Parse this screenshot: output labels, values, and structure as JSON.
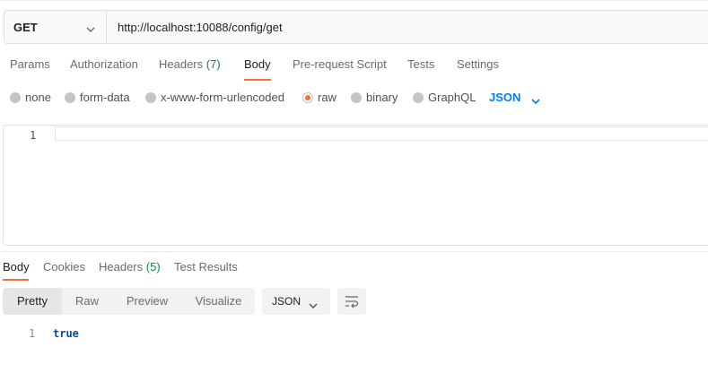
{
  "request": {
    "method": "GET",
    "url": "http://localhost:10088/config/get"
  },
  "request_tabs": [
    {
      "label": "Params"
    },
    {
      "label": "Authorization"
    },
    {
      "label": "Headers",
      "count": "(7)"
    },
    {
      "label": "Body",
      "active": true
    },
    {
      "label": "Pre-request Script"
    },
    {
      "label": "Tests"
    },
    {
      "label": "Settings"
    }
  ],
  "body_types": [
    {
      "label": "none"
    },
    {
      "label": "form-data"
    },
    {
      "label": "x-www-form-urlencoded"
    },
    {
      "label": "raw",
      "selected": true
    },
    {
      "label": "binary"
    },
    {
      "label": "GraphQL"
    }
  ],
  "body_language": "JSON",
  "editor": {
    "line_numbers": [
      "1"
    ],
    "content": ""
  },
  "response_tabs": [
    {
      "label": "Body",
      "active": true
    },
    {
      "label": "Cookies"
    },
    {
      "label": "Headers",
      "count": "(5)"
    },
    {
      "label": "Test Results"
    }
  ],
  "response_views": [
    {
      "label": "Pretty",
      "active": true
    },
    {
      "label": "Raw"
    },
    {
      "label": "Preview"
    },
    {
      "label": "Visualize"
    }
  ],
  "response_format": "JSON",
  "response_body": {
    "line_numbers": [
      "1"
    ],
    "lines": [
      "true"
    ]
  },
  "icons": {
    "method_dropdown": "chevron-down-icon",
    "language_dropdown": "chevron-down-icon",
    "format_dropdown": "chevron-down-icon",
    "wrap": "wrap-lines-icon"
  },
  "colors": {
    "accent": "#ff6c37",
    "link_blue": "#097bed",
    "count_green": "#0a8a3e",
    "code_value": "#0c4a99"
  }
}
